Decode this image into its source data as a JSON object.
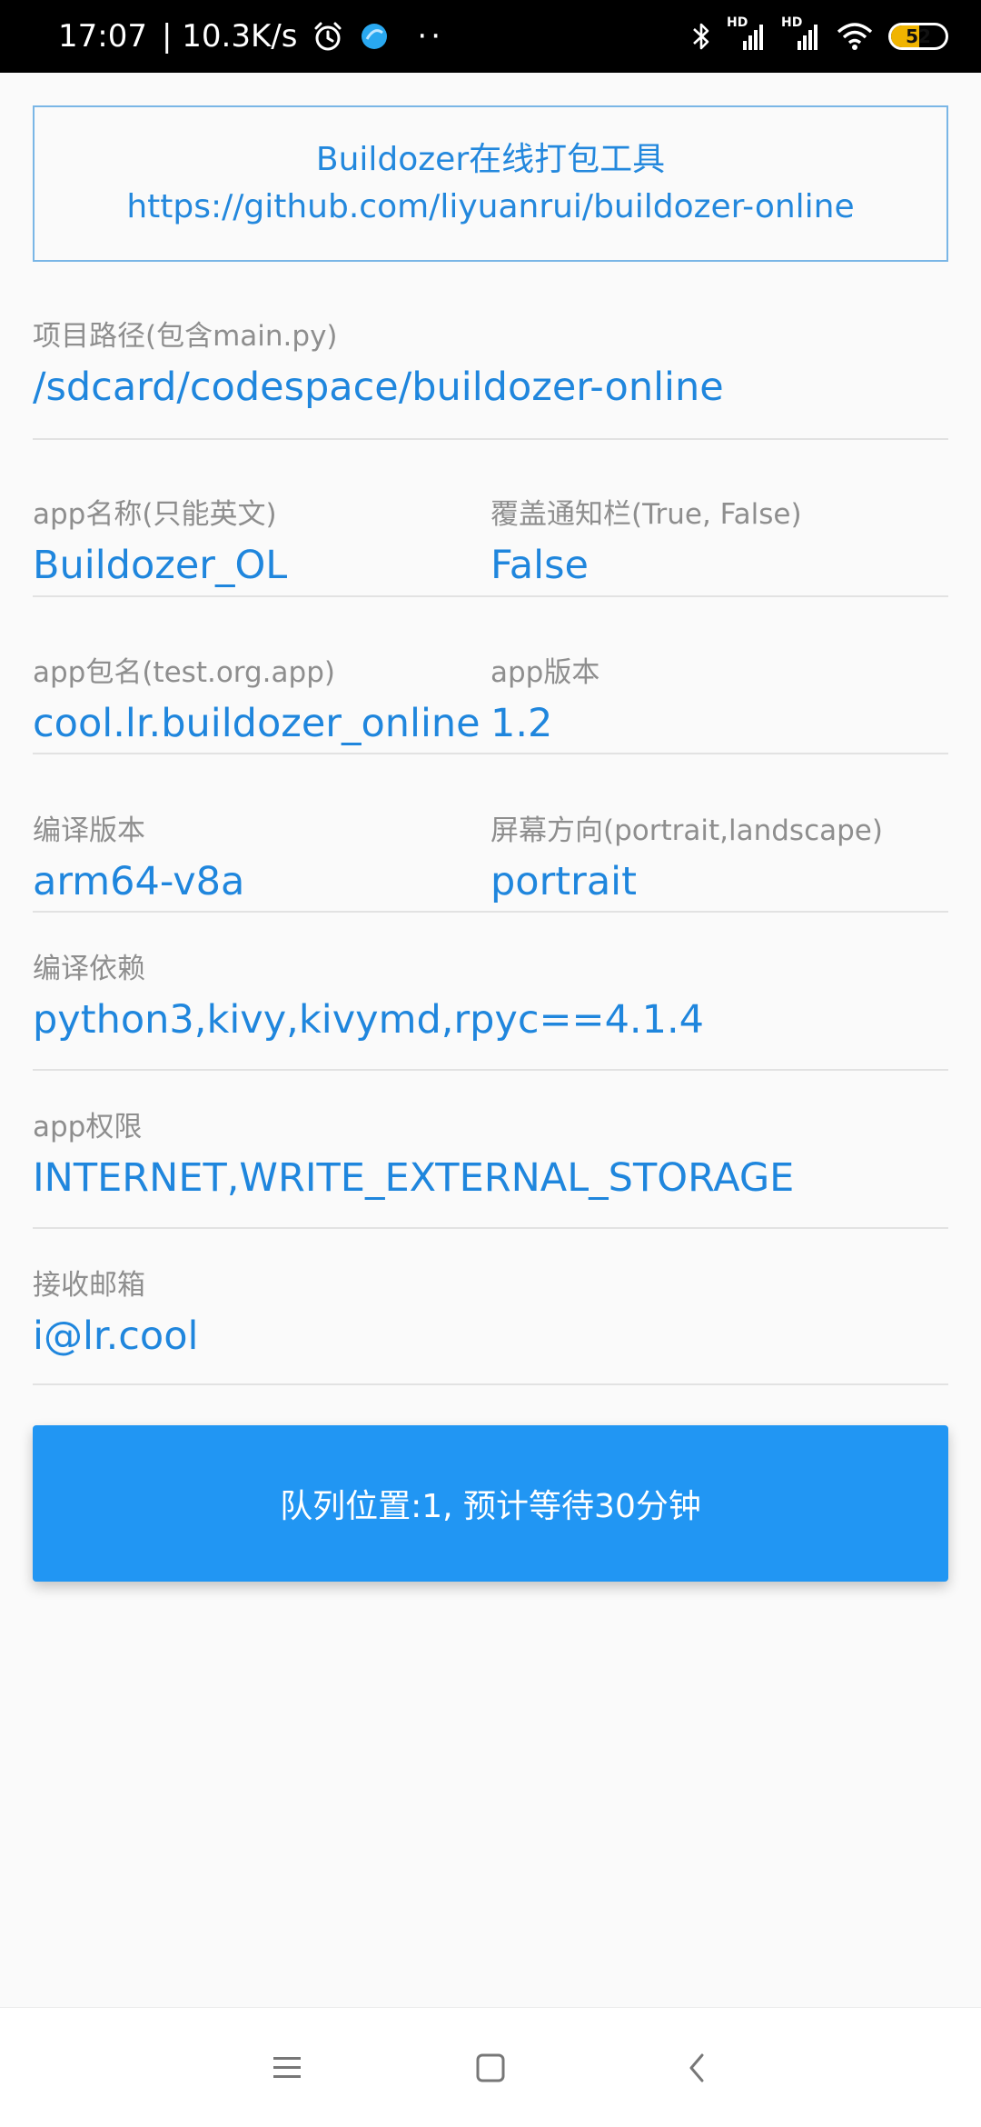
{
  "status_bar": {
    "time": "17:07",
    "net_speed": "| 10.3K/s",
    "battery": "52",
    "hd1": "HD",
    "hd2": "HD",
    "dots": "··"
  },
  "header": {
    "title": "Buildozer在线打包工具",
    "url": "https://github.com/liyuanrui/buildozer-online"
  },
  "fields": {
    "project_path": {
      "label": "项目路径(包含main.py)",
      "value": "/sdcard/codespace/buildozer-online"
    },
    "app_name": {
      "label": "app名称(只能英文)",
      "value": "Buildozer_OL"
    },
    "fullscreen": {
      "label": "覆盖通知栏(True, False)",
      "value": "False"
    },
    "package_name": {
      "label": "app包名(test.org.app)",
      "value": "cool.lr.buildozer_online"
    },
    "app_version": {
      "label": "app版本",
      "value": "1.2"
    },
    "arch": {
      "label": "编译版本",
      "value": "arm64-v8a"
    },
    "orientation": {
      "label": "屏幕方向(portrait,landscape)",
      "value": "portrait"
    },
    "requirements": {
      "label": "编译依赖",
      "value": "python3,kivy,kivymd,rpyc==4.1.4"
    },
    "permissions": {
      "label": "app权限",
      "value": "INTERNET,WRITE_EXTERNAL_STORAGE"
    },
    "email": {
      "label": "接收邮箱",
      "value": "i@lr.cool"
    }
  },
  "queue_button": {
    "label": "队列位置:1, 预计等待30分钟"
  },
  "nav": {
    "menu_icon": "menu-icon",
    "home_icon": "home-square-icon",
    "back_icon": "back-chevron-icon"
  },
  "colors": {
    "accent": "#2196f3",
    "value_text": "#1f86dd",
    "label_text": "#8e8e8e"
  }
}
